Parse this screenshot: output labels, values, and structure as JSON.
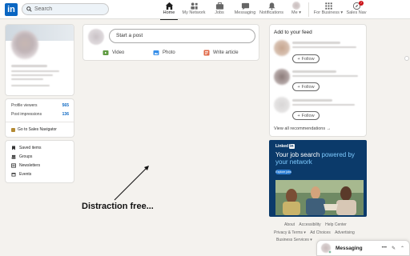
{
  "nav": {
    "logo": "in",
    "search_placeholder": "Search",
    "items": [
      {
        "label": "Home",
        "icon": "home-icon"
      },
      {
        "label": "My Network",
        "icon": "network-icon"
      },
      {
        "label": "Jobs",
        "icon": "briefcase-icon"
      },
      {
        "label": "Messaging",
        "icon": "chat-icon"
      },
      {
        "label": "Notifications",
        "icon": "bell-icon"
      },
      {
        "label": "Me ▾",
        "icon": "avatar"
      },
      {
        "label": "For Business ▾",
        "icon": "grid-icon"
      },
      {
        "label": "Sales Nav",
        "icon": "compass-icon"
      }
    ],
    "sales_badge": "7"
  },
  "left": {
    "stats": [
      {
        "label": "Profile viewers",
        "value": "565"
      },
      {
        "label": "Post impressions",
        "value": "136"
      }
    ],
    "sales_navigator": "Go to Sales Navigator",
    "links": [
      "Saved items",
      "Groups",
      "Newsletters",
      "Events"
    ]
  },
  "share": {
    "prompt": "Start a post",
    "actions": [
      {
        "label": "Video",
        "color": "#378fe9"
      },
      {
        "label": "Photo",
        "color": "#5f9b41"
      },
      {
        "label": "Write article",
        "color": "#e06847"
      }
    ]
  },
  "feed": {
    "title": "Add to your feed",
    "follow_label": "Follow",
    "view_all": "View all recommendations →"
  },
  "ad": {
    "brand": "Linked",
    "brand_in": "in",
    "headline_1": "Your job search ",
    "headline_2": "powered by",
    "headline_3": "your network",
    "button": "Explore jobs"
  },
  "footer": {
    "row1": [
      "About",
      "Accessibility",
      "Help Center"
    ],
    "row2": [
      "Privacy & Terms ▾",
      "Ad Choices",
      "Advertising"
    ],
    "row3": [
      "Business Services ▾"
    ]
  },
  "annotation": "Distraction free...",
  "messaging": {
    "label": "Messaging",
    "tools": [
      "•••",
      "✎",
      "⌃"
    ]
  },
  "colors": {
    "brand": "#0a66c2",
    "background": "#f4f2ee",
    "ad_bg": "#0b3a6a"
  }
}
